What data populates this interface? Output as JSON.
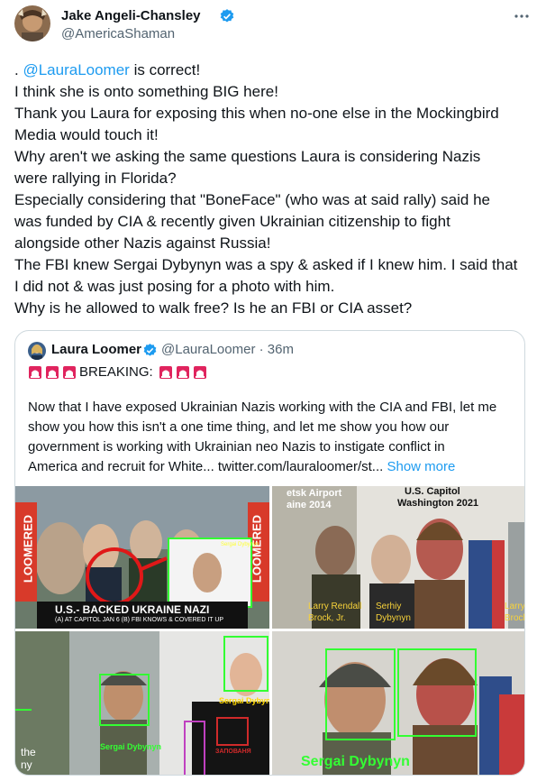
{
  "tweet": {
    "author_name": "Jake Angeli-Chansley",
    "author_handle": "@AmericaShaman",
    "more_icon": "more-horizontal-icon",
    "lines": [
      {
        "pre": ". ",
        "mention": "@LauraLoomer",
        "post": " is correct!"
      },
      {
        "text": "I think she is onto something BIG here!"
      },
      {
        "text": "Thank you Laura for exposing this when no-one else in the Mockingbird"
      },
      {
        "text": "Media would touch it!"
      },
      {
        "text": "Why aren't we asking the same questions Laura is considering Nazis"
      },
      {
        "text": "were rallying in Florida?"
      },
      {
        "text": "Especially considering that \"BoneFace\" (who was at said rally) said he"
      },
      {
        "text": "was funded by CIA & recently given Ukrainian citizenship to fight"
      },
      {
        "text": "alongside other Nazis against Russia!"
      },
      {
        "text": "The FBI knew Sergai Dybynyn was a spy & asked if I knew him. I said that"
      },
      {
        "text": "I did not & was just posing for a photo with him."
      },
      {
        "text": "Why is he allowed to walk free? Is he an FBI or CIA asset?"
      }
    ]
  },
  "quote": {
    "author_name": "Laura Loomer",
    "author_handle": "@LauraLoomer",
    "separator": "·",
    "time": "36m",
    "breaking": "BREAKING:",
    "siren_icon": "police-siren-icon",
    "body_lines": [
      "Now that I have exposed Ukrainian Nazis working with the CIA and FBI, let me",
      "show you how this isn't a one time thing, and let me show you how our",
      "government is working with Ukrainian neo Nazis to instigate conflict in",
      "America and recruit for White...  twitter.com/lauraloomer/st..."
    ],
    "show_more": "Show more"
  },
  "images": {
    "img1": {
      "brand": "LOOMERED",
      "headline": "U.S.- BACKED UKRAINE NAZI",
      "subline": "(A) AT CAPITOL JAN 6  (B) FBI KNOWS & COVERED IT UP",
      "inset_label": "Sergai Dybynyn"
    },
    "img2": {
      "left_caption_1": "etsk Airport",
      "left_caption_2": "aine 2014",
      "right_caption_1": "U.S. Capitol",
      "right_caption_2": "Washington 2021",
      "name_1a": "Larry Rendall",
      "name_1b": "Brock, Jr.",
      "name_2a": "Serhiy",
      "name_2b": "Dybynyn",
      "name_3a": "Larry R",
      "name_3b": "Brock,"
    },
    "img3": {
      "label_1": "Sergai Dybynyn",
      "label_2": "Sergai Dybynyn",
      "corner_1": "the",
      "corner_2": "ny",
      "shirt_text": "ЗАПОВАНЯ"
    },
    "img4": {
      "label": "Sergai Dybynyn"
    }
  }
}
